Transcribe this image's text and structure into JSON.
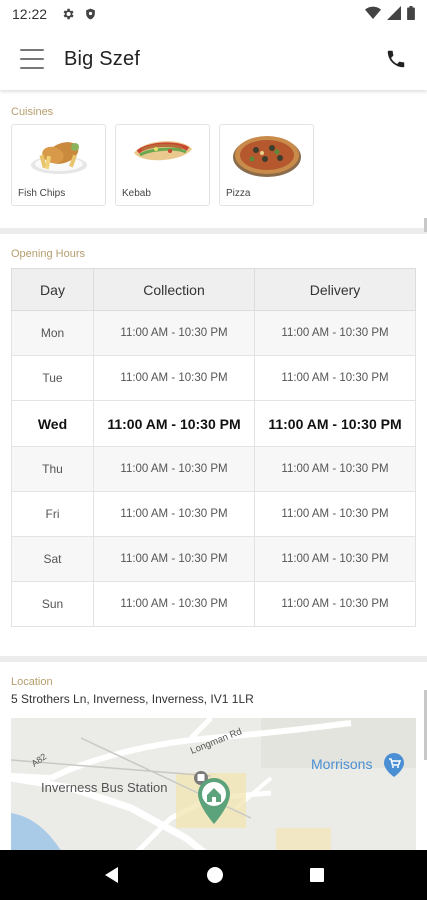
{
  "status_bar": {
    "time": "12:22"
  },
  "app_bar": {
    "title": "Big Szef"
  },
  "cuisines": {
    "title": "Cuisines",
    "items": [
      {
        "label": "Fish  Chips",
        "icon": "fish-chips-image"
      },
      {
        "label": "Kebab",
        "icon": "kebab-image"
      },
      {
        "label": "Pizza",
        "icon": "pizza-image"
      }
    ]
  },
  "opening_hours": {
    "title": "Opening Hours",
    "headers": [
      "Day",
      "Collection",
      "Delivery"
    ],
    "rows": [
      {
        "day": "Mon",
        "collection": "11:00 AM - 10:30 PM",
        "delivery": "11:00 AM - 10:30 PM"
      },
      {
        "day": "Tue",
        "collection": "11:00 AM - 10:30 PM",
        "delivery": "11:00 AM - 10:30 PM"
      },
      {
        "day": "Wed",
        "collection": "11:00 AM - 10:30 PM",
        "delivery": "11:00 AM - 10:30 PM",
        "today": true
      },
      {
        "day": "Thu",
        "collection": "11:00 AM - 10:30 PM",
        "delivery": "11:00 AM - 10:30 PM"
      },
      {
        "day": "Fri",
        "collection": "11:00 AM - 10:30 PM",
        "delivery": "11:00 AM - 10:30 PM"
      },
      {
        "day": "Sat",
        "collection": "11:00 AM - 10:30 PM",
        "delivery": "11:00 AM - 10:30 PM"
      },
      {
        "day": "Sun",
        "collection": "11:00 AM - 10:30 PM",
        "delivery": "11:00 AM - 10:30 PM"
      }
    ]
  },
  "location": {
    "title": "Location",
    "address": "5 Strothers Ln, Inverness, Inverness, IV1 1LR",
    "map": {
      "labels": {
        "bus_station": "Inverness Bus Station",
        "supermarket": "Morrisons",
        "road_1": "Longman Rd",
        "road_2": "A82"
      }
    }
  },
  "colors": {
    "section_title": "#b59e6e",
    "table_header_bg": "#efefef",
    "map_marker": "#5ca27a",
    "supermarket_marker": "#4a8fd4"
  }
}
